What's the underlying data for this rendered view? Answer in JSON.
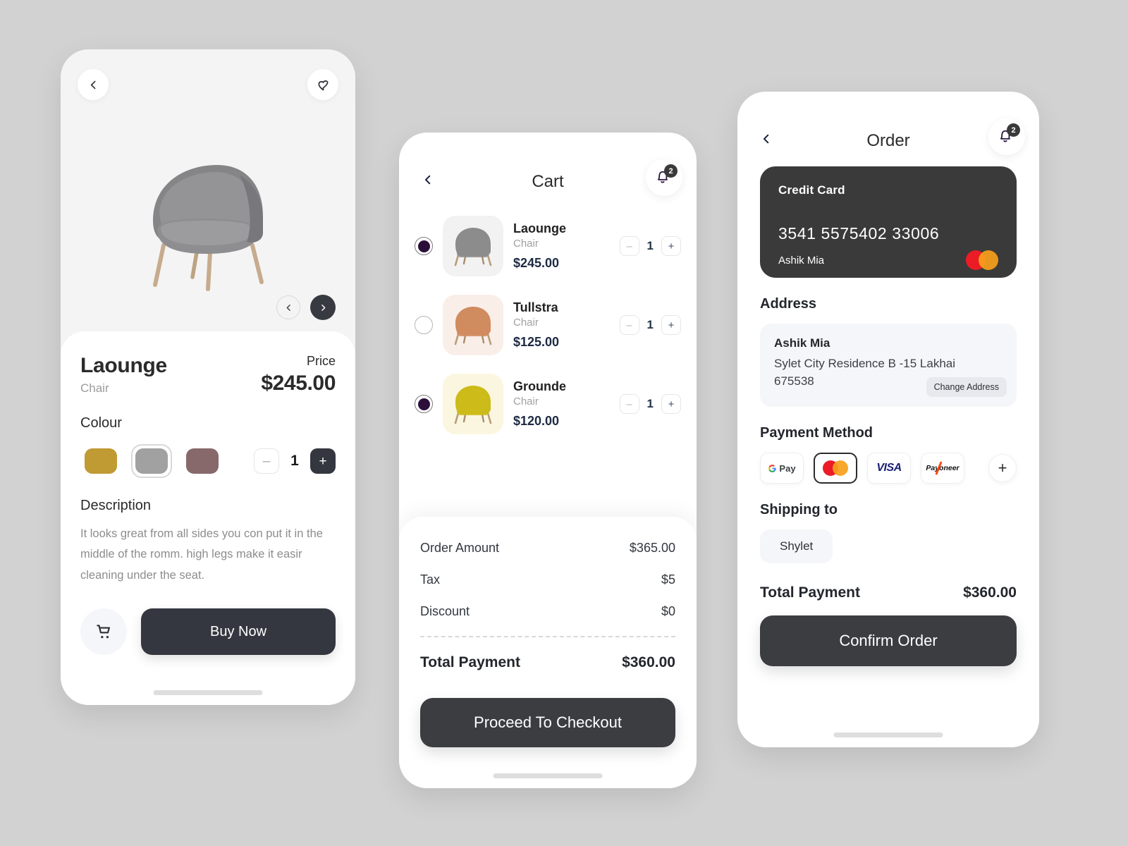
{
  "background_color": "#d2d2d2",
  "product_screen": {
    "back_icon": "chevron-left-icon",
    "favorite_icon": "heart-icon",
    "carousel_prev_icon": "chevron-left-icon",
    "carousel_next_icon": "chevron-right-icon",
    "name": "Laounge",
    "category": "Chair",
    "price_label": "Price",
    "price": "$245.00",
    "colour_label": "Colour",
    "colours": [
      {
        "name": "gold",
        "hex": "#C09A33",
        "selected": false
      },
      {
        "name": "grey",
        "hex": "#A1A1A1",
        "selected": true
      },
      {
        "name": "mauve",
        "hex": "#87696C",
        "selected": false
      }
    ],
    "quantity": "1",
    "minus_label": "–",
    "plus_label": "+",
    "description_label": "Description",
    "description": "It looks great from all sides you con put it in the middle of the romm. high legs make it easir cleaning under the seat.",
    "cart_icon": "shopping-cart-icon",
    "buy_label": "Buy Now"
  },
  "cart_screen": {
    "back_icon": "chevron-left-icon",
    "title": "Cart",
    "bell_icon": "bell-icon",
    "notification_count": "2",
    "items": [
      {
        "name": "Laounge",
        "category": "Chair",
        "price": "$245.00",
        "quantity": "1",
        "selected": true,
        "thumb_bg": "#f2f2f2",
        "chair_color": "#8c8c8c"
      },
      {
        "name": "Tullstra",
        "category": "Chair",
        "price": "$125.00",
        "quantity": "1",
        "selected": false,
        "thumb_bg": "#faeee8",
        "chair_color": "#d08b5f"
      },
      {
        "name": "Grounde",
        "category": "Chair",
        "price": "$120.00",
        "quantity": "1",
        "selected": true,
        "thumb_bg": "#fbf6e0",
        "chair_color": "#ccbb18"
      }
    ],
    "minus_label": "–",
    "plus_label": "+",
    "summary": [
      {
        "label": "Order Amount",
        "value": "$365.00"
      },
      {
        "label": "Tax",
        "value": "$5"
      },
      {
        "label": "Discount",
        "value": "$0"
      }
    ],
    "total_label": "Total Payment",
    "total_value": "$360.00",
    "checkout_label": "Proceed To Checkout"
  },
  "order_screen": {
    "back_icon": "chevron-left-icon",
    "title": "Order",
    "bell_icon": "bell-icon",
    "notification_count": "2",
    "card": {
      "label": "Credit Card",
      "number": "3541  5575402  33006",
      "holder": "Ashik Mia",
      "brand_icon": "mastercard-icon"
    },
    "address_title": "Address",
    "address": {
      "name": "Ashik Mia",
      "line": "Sylet City Residence B -15 Lakhai 675538",
      "change_label": "Change Address"
    },
    "payment_title": "Payment Method",
    "payment_methods": [
      {
        "name": "google-pay",
        "label": "Pay",
        "selected": false
      },
      {
        "name": "mastercard",
        "label": "",
        "selected": true
      },
      {
        "name": "visa",
        "label": "VISA",
        "selected": false
      },
      {
        "name": "payoneer",
        "label": "Payoneer",
        "selected": false
      }
    ],
    "add_payment_label": "+",
    "shipping_title": "Shipping to",
    "shipping_city": "Shylet",
    "total_label": "Total Payment",
    "total_value": "$360.00",
    "confirm_label": "Confirm Order"
  }
}
